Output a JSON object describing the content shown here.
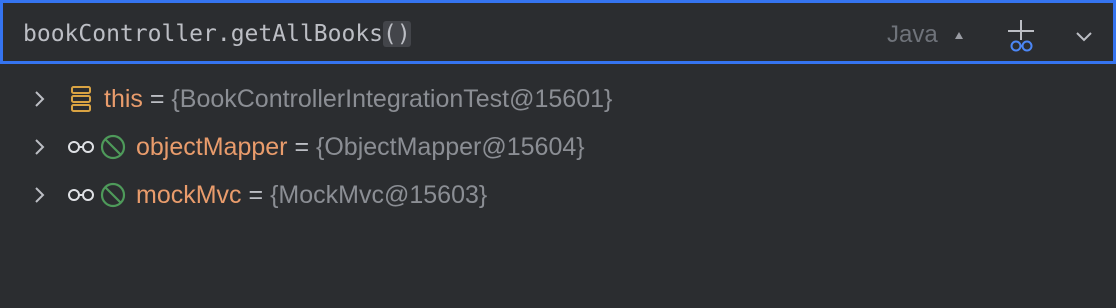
{
  "evaluate": {
    "expression": "bookController.getAllBooks",
    "parens": "()",
    "language": "Java"
  },
  "colors": {
    "accent": "#3574f0",
    "background": "#2b2d30",
    "name": "#e99c6c",
    "value": "#8b8e94",
    "field_icon_green": "#4e9a5a",
    "this_icon_orange": "#d9a343"
  },
  "variables": [
    {
      "name": "this",
      "equals": "=",
      "value": "{BookControllerIntegrationTest@15601}",
      "icon": "stack-icon"
    },
    {
      "name": "objectMapper",
      "equals": "=",
      "value": "{ObjectMapper@15604}",
      "icon": "watch-field-icon"
    },
    {
      "name": "mockMvc",
      "equals": "=",
      "value": "{MockMvc@15603}",
      "icon": "watch-field-icon"
    }
  ]
}
